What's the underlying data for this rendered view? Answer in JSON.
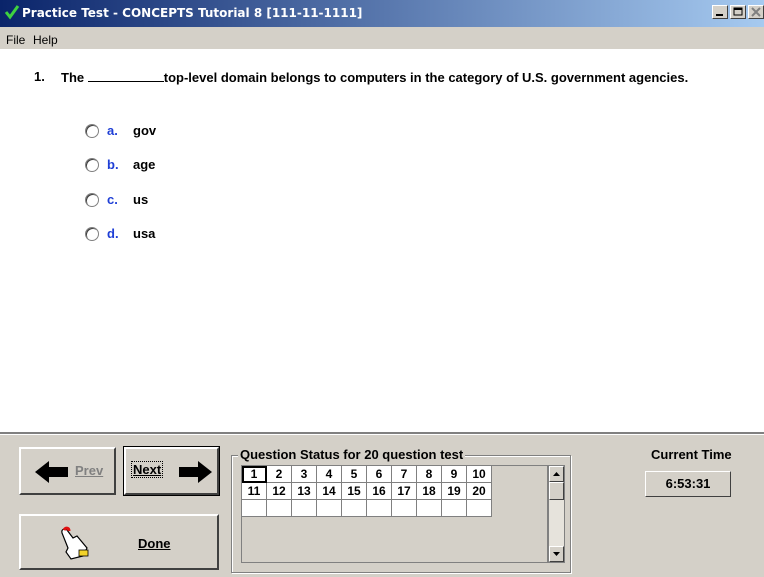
{
  "window": {
    "title": "Practice Test - CONCEPTS Tutorial 8 [111-11-1111]"
  },
  "menu": {
    "file": "File",
    "help": "Help"
  },
  "question": {
    "number": "1.",
    "text_before": "The",
    "text_after": "top-level domain belongs to computers in the category of U.S. government agencies.",
    "choices": [
      {
        "letter": "a.",
        "text": "gov"
      },
      {
        "letter": "b.",
        "text": "age"
      },
      {
        "letter": "c.",
        "text": "us"
      },
      {
        "letter": "d.",
        "text": "usa"
      }
    ]
  },
  "nav": {
    "prev_label": "Prev",
    "next_label": "Next",
    "done_label": "Done"
  },
  "status": {
    "label": "Question Status for 20 question test",
    "row1": [
      "1",
      "2",
      "3",
      "4",
      "5",
      "6",
      "7",
      "8",
      "9",
      "10"
    ],
    "row2": [
      "11",
      "12",
      "13",
      "14",
      "15",
      "16",
      "17",
      "18",
      "19",
      "20"
    ],
    "current": "1"
  },
  "clock": {
    "label": "Current Time",
    "value": "6:53:31"
  }
}
